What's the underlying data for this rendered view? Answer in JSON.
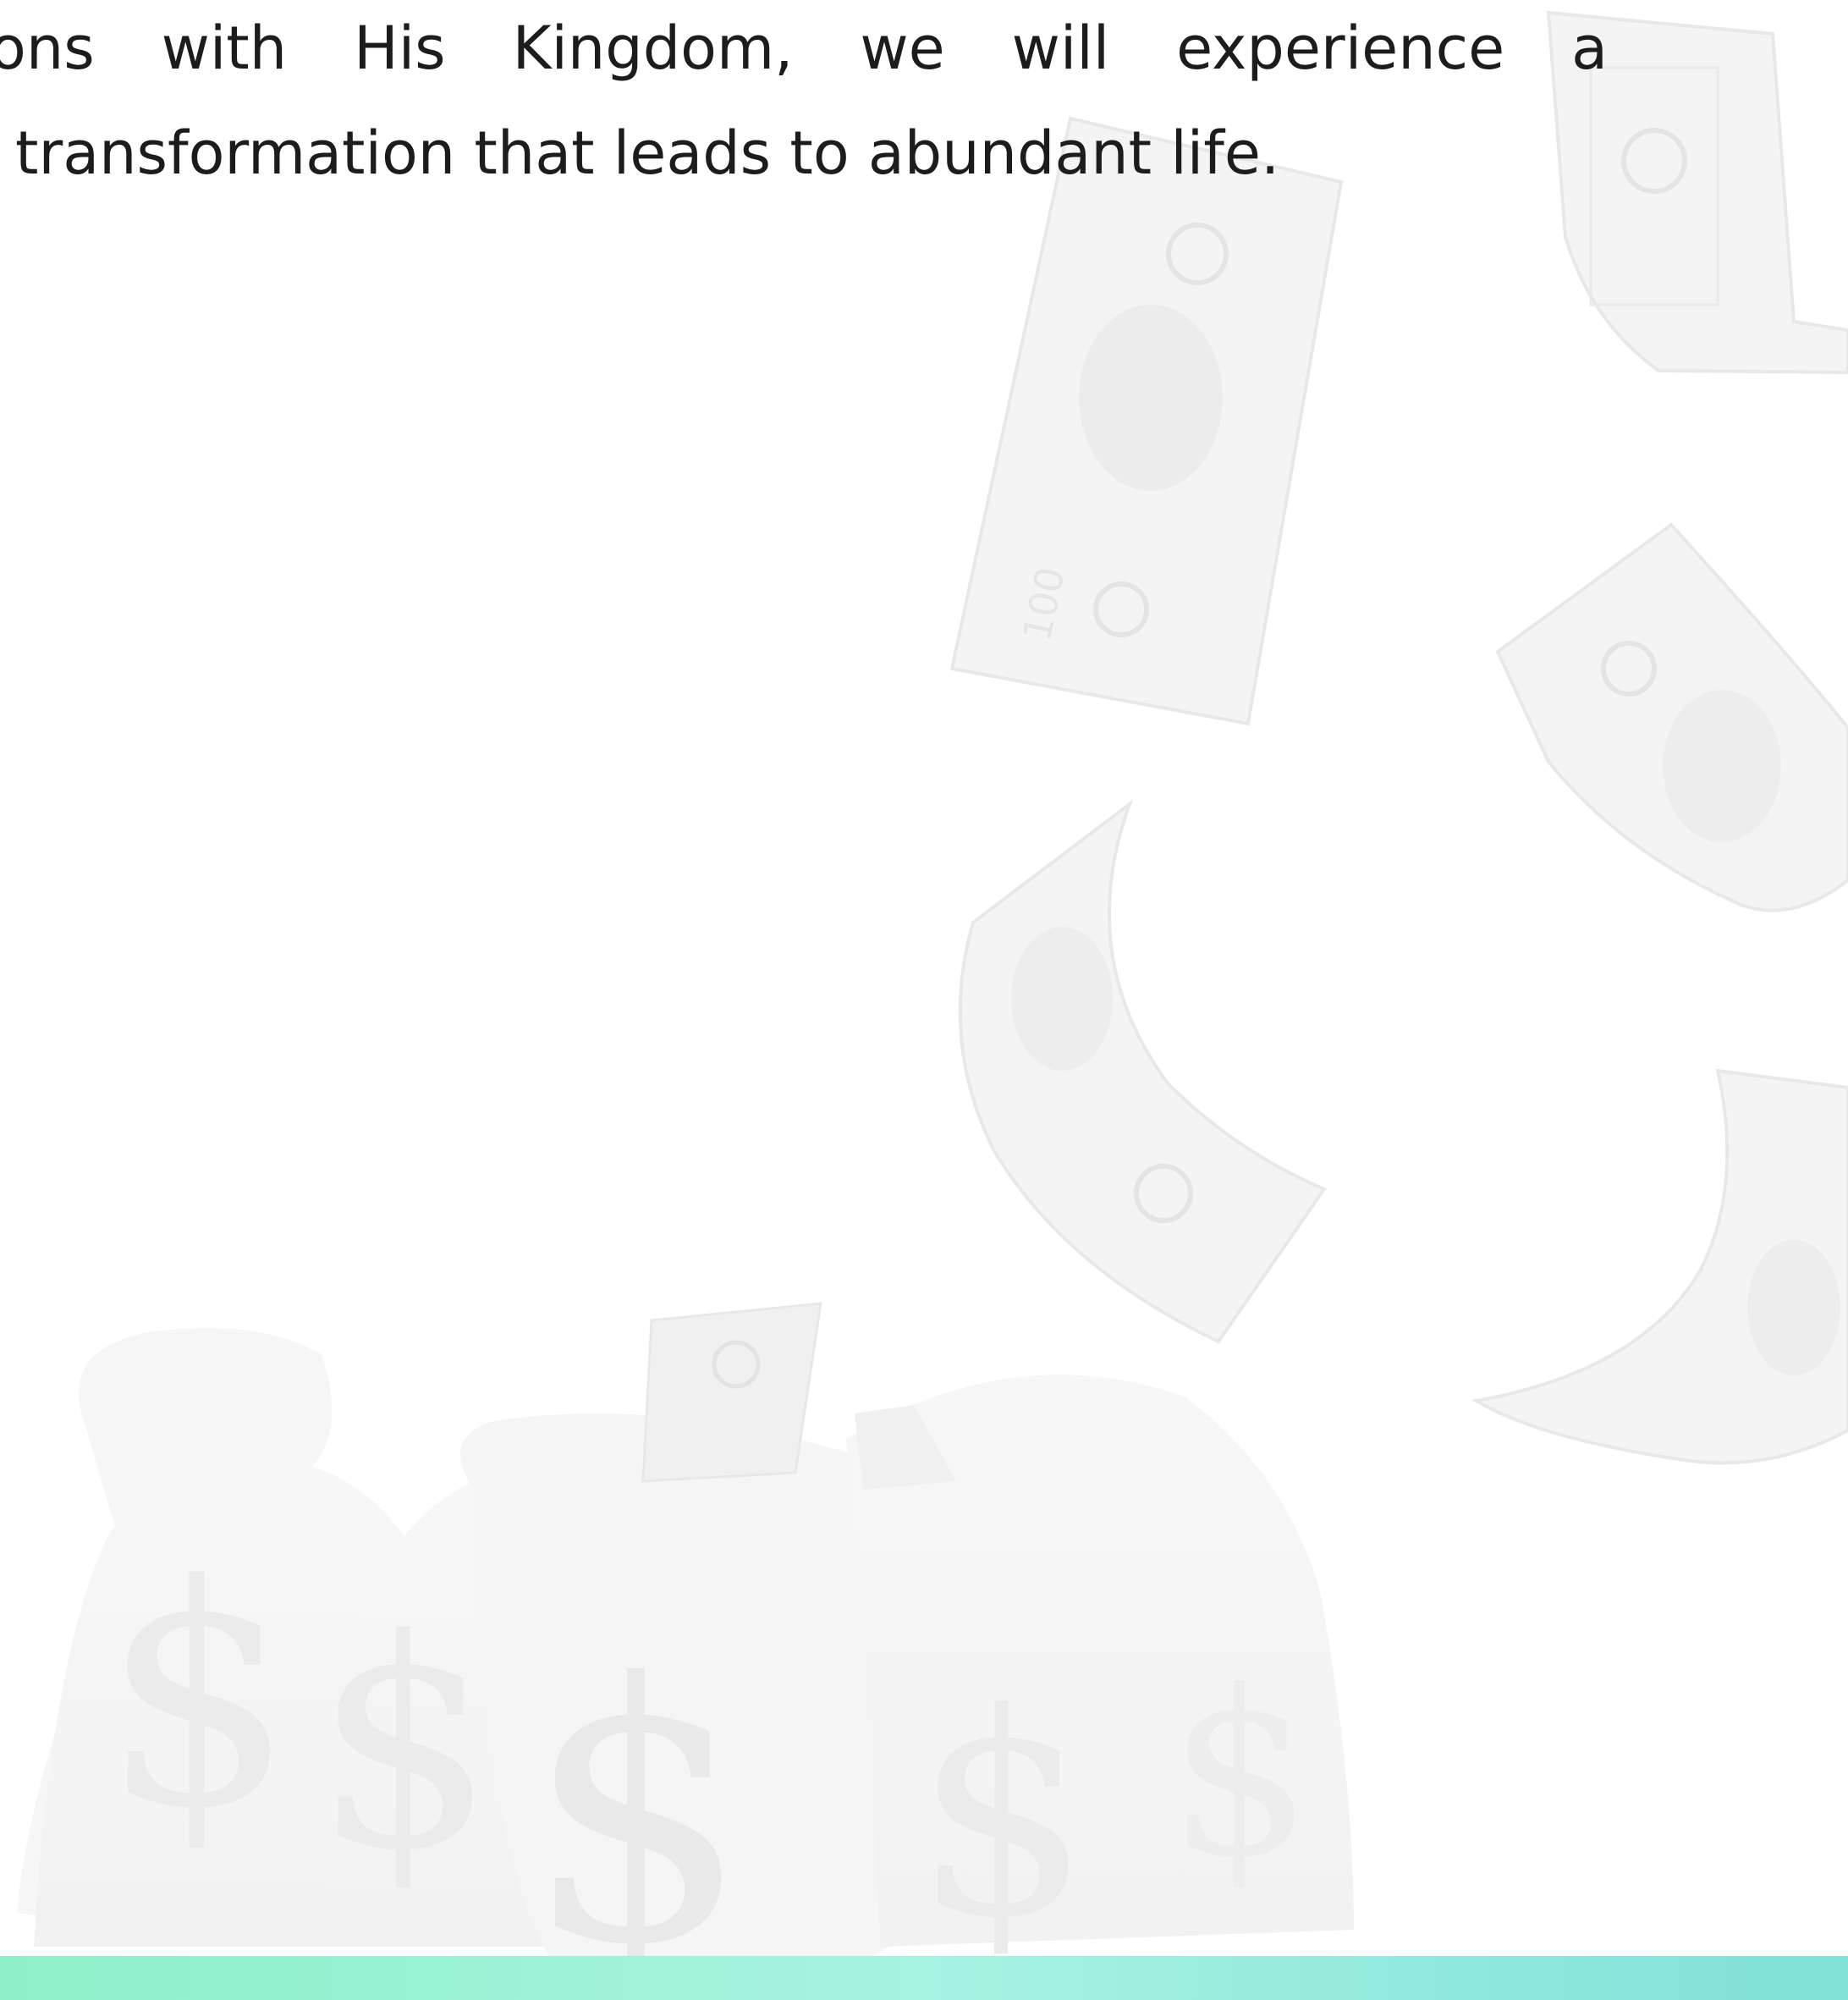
{
  "document": {
    "line_1_words": [
      "ons",
      "with",
      "His",
      "Kingdom,",
      "we",
      "will",
      "experience",
      "a"
    ],
    "line_2": "transformation that leads to abundant life."
  },
  "decor": {
    "background_image": "falling-money-bags-icon",
    "bottom_bar_gradient": [
      "#8ef0c8",
      "#a8f3e2",
      "#7fe0d6"
    ],
    "watermark_tint": "#ececec"
  }
}
